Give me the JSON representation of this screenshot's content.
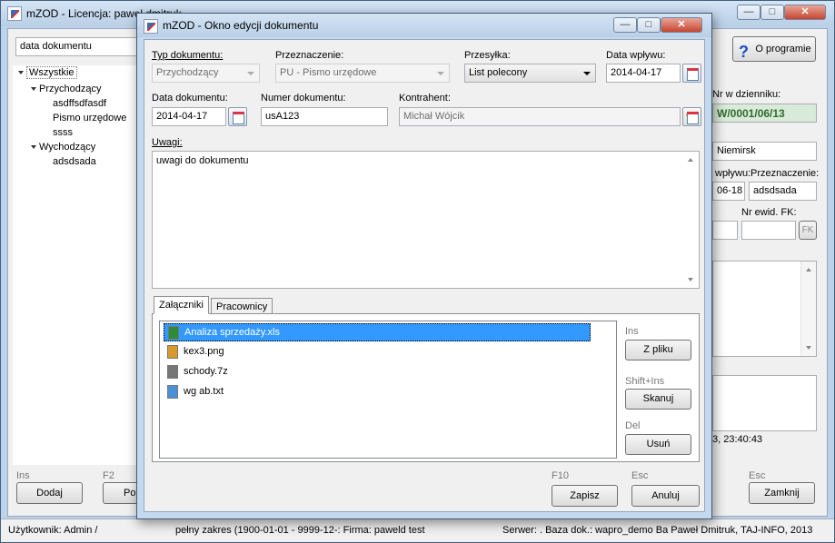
{
  "main_window": {
    "title": "mZOD - Licencja: paweł dmitruk",
    "sort_combo": "data dokumentu",
    "about_button": "O programie",
    "tree": [
      {
        "label": "Wszystkie",
        "level": 0
      },
      {
        "label": "Przychodzący",
        "level": 1
      },
      {
        "label": "asdffsdfasdf",
        "level": 2
      },
      {
        "label": "Pismo urzędowe",
        "level": 2
      },
      {
        "label": "ssss",
        "level": 2
      },
      {
        "label": "Wychodzący",
        "level": 1
      },
      {
        "label": "adsdsada",
        "level": 2
      }
    ],
    "right_panel": {
      "journal_label": "Nr w dzienniku:",
      "journal_value": "W/0001/06/13",
      "contractor_fragment": "Niemirsk",
      "receipt_date_label": "wpływu:",
      "receipt_date_value": "06-18",
      "purpose_label": "Przeznaczenie:",
      "purpose_value": "adsdsada",
      "fk_label": "Nr ewid. FK:",
      "fk_button": "FK",
      "time_fragment": "3, 23:40:43"
    },
    "bottom": {
      "add_shortcut": "Ins",
      "add_button": "Dodaj",
      "edit_shortcut": "F2",
      "edit_button": "Pop",
      "close_shortcut": "Esc",
      "close_button": "Zamknij"
    },
    "status": {
      "user": "Użytkownik: Admin /",
      "range": "pełny zakres (1900-01-01 - 9999-12-: Firma: paweld test",
      "server": "Serwer: . Baza dok.: wapro_demo Ba Paweł Dmitruk, TAJ-INFO, 2013"
    }
  },
  "dialog": {
    "title": "mZOD - Okno edycji dokumentu",
    "doc_type_label": "Typ dokumentu:",
    "doc_type_value": "Przychodzący",
    "purpose_label": "Przeznaczenie:",
    "purpose_value": "PU - Pismo urzędowe",
    "shipment_label": "Przesyłka:",
    "shipment_value": "List polecony",
    "receipt_date_label": "Data wpływu:",
    "receipt_date_value": "2014-04-17",
    "doc_date_label": "Data dokumentu:",
    "doc_date_value": "2014-04-17",
    "doc_number_label": "Numer dokumentu:",
    "doc_number_value": "usA123",
    "contractor_label": "Kontrahent:",
    "contractor_value": "Michał Wójcik",
    "notes_label": "Uwagi:",
    "notes_value": "uwagi do dokumentu",
    "tabs": [
      "Załączniki",
      "Pracownicy"
    ],
    "attachments": [
      {
        "name": "Analiza sprzedaży.xls",
        "icon": "excel-file-icon",
        "color": "#2e8b3a",
        "selected": true
      },
      {
        "name": "kex3.png",
        "icon": "image-file-icon",
        "color": "#d89a2a",
        "selected": false
      },
      {
        "name": "schody.7z",
        "icon": "archive-file-icon",
        "color": "#777777",
        "selected": false
      },
      {
        "name": "wg ab.txt",
        "icon": "text-file-icon",
        "color": "#4a90d9",
        "selected": false
      }
    ],
    "from_file_shortcut": "Ins",
    "from_file_button": "Z pliku",
    "scan_shortcut": "Shift+Ins",
    "scan_button": "Skanuj",
    "delete_shortcut": "Del",
    "delete_button": "Usuń",
    "save_shortcut": "F10",
    "save_button": "Zapisz",
    "cancel_shortcut": "Esc",
    "cancel_button": "Anuluj"
  },
  "colors": {
    "selection": "#3399ff",
    "journal_bg": "#d8ead8"
  }
}
